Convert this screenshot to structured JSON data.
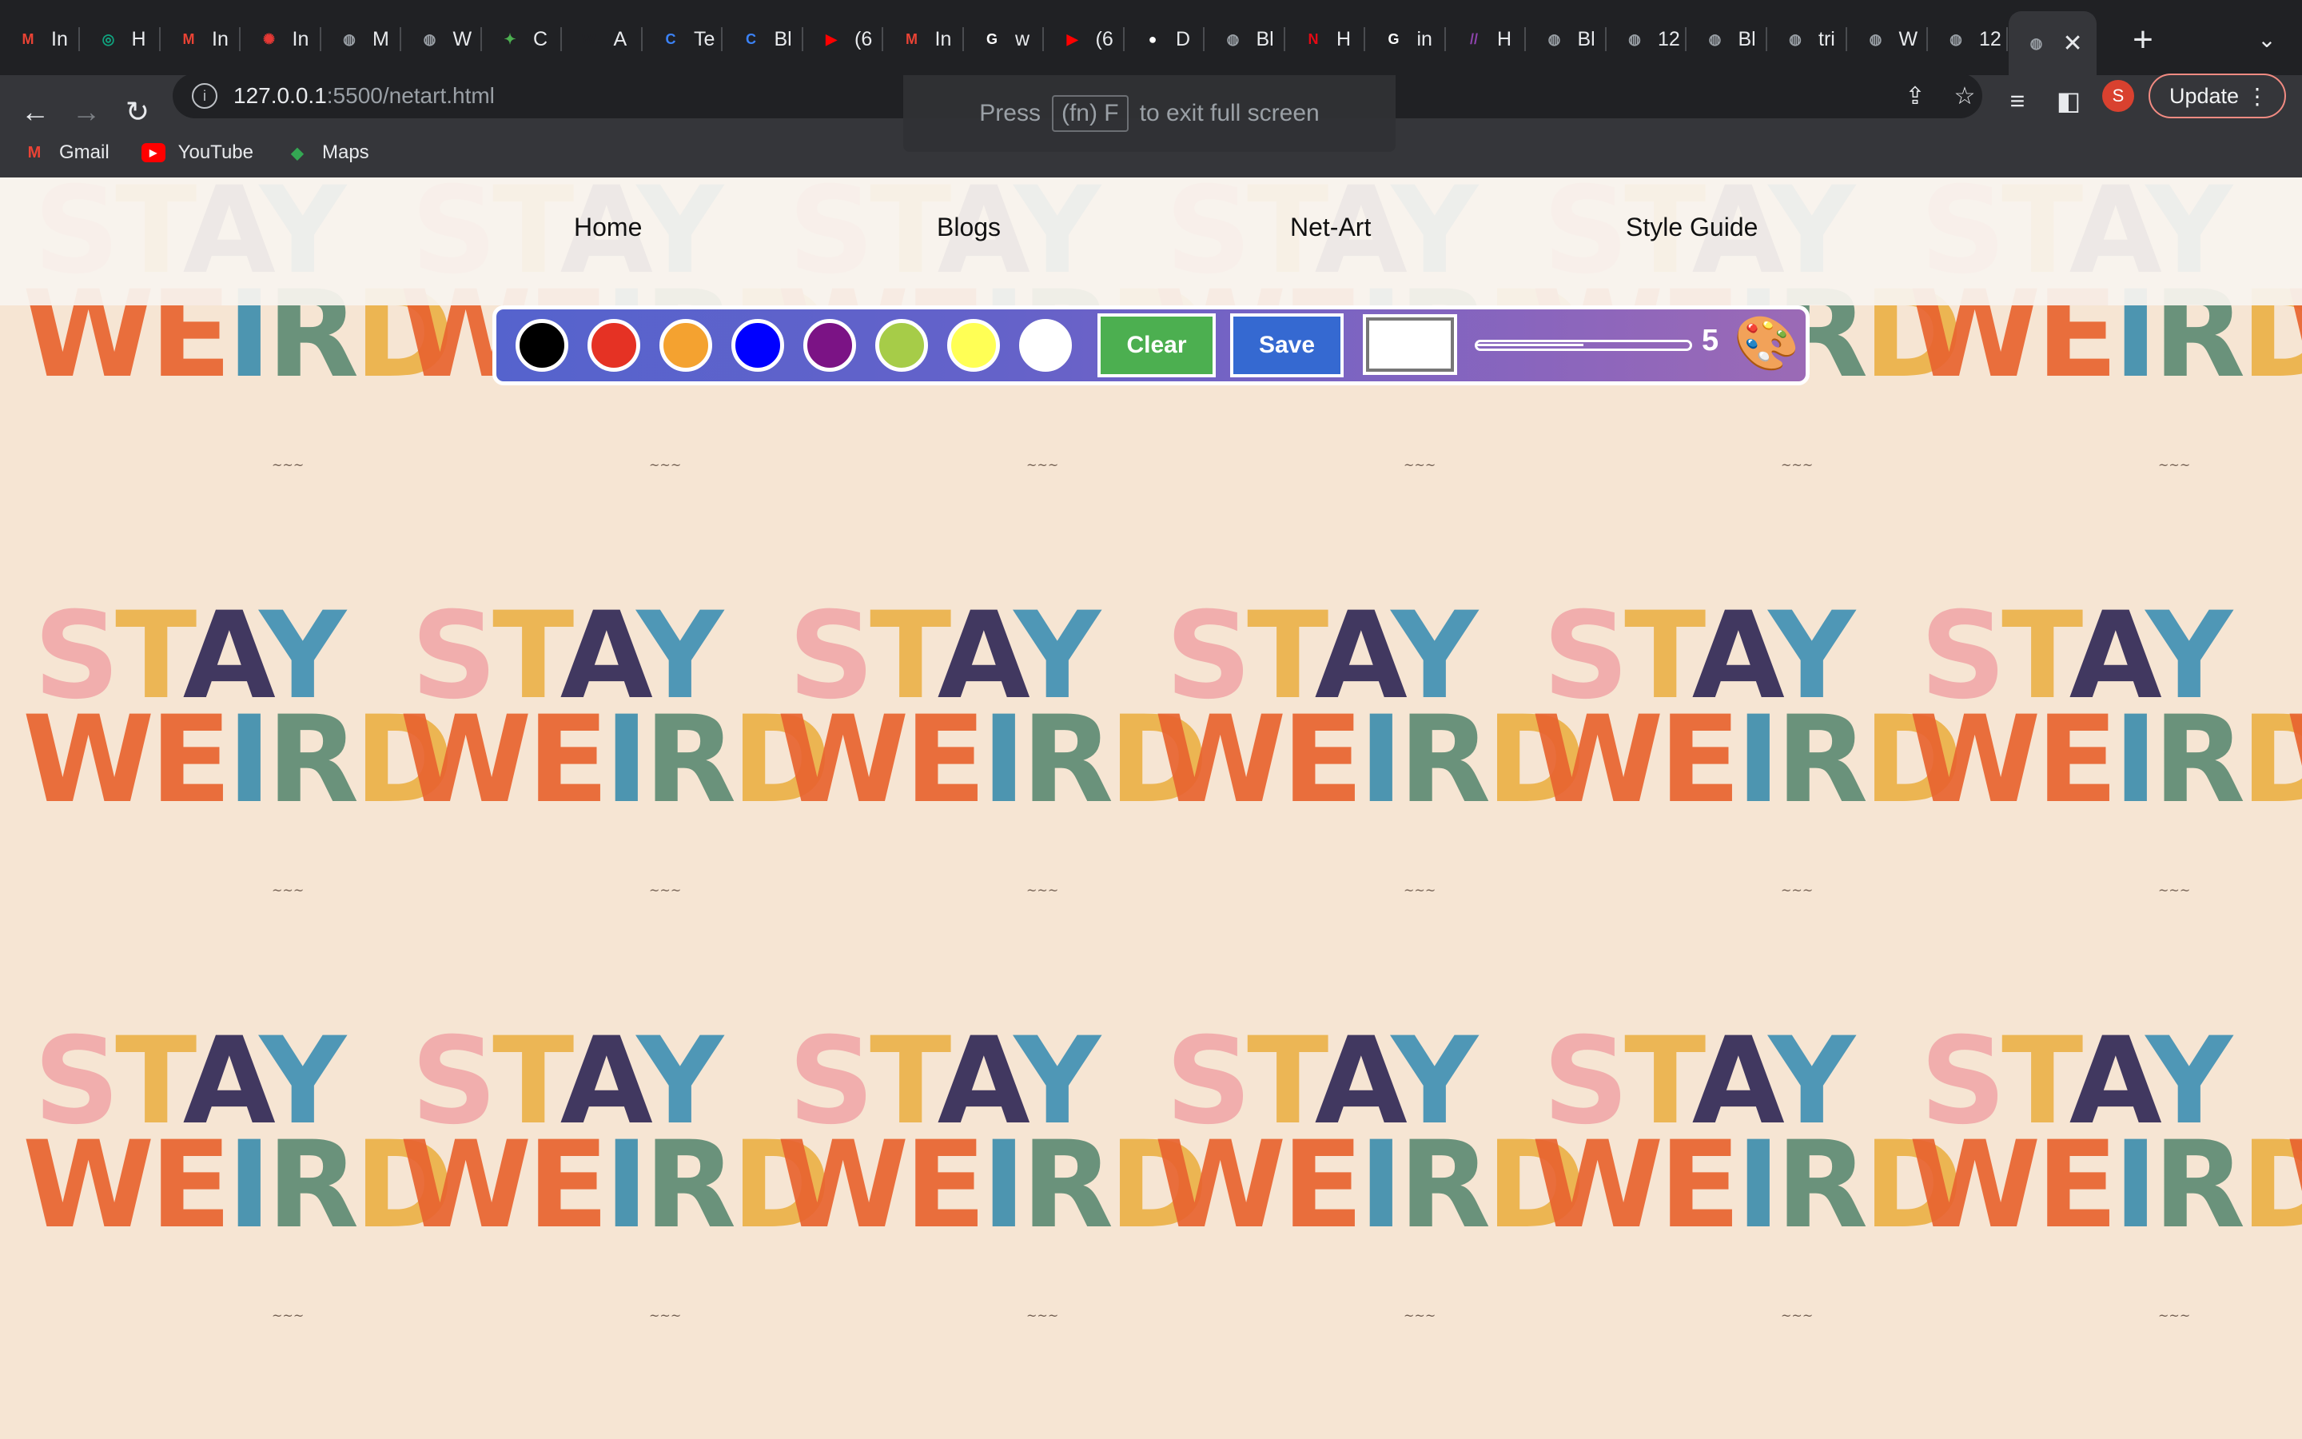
{
  "browser": {
    "tabs": [
      {
        "title": "In",
        "icon": "gmail-icon",
        "color": "#ea4335",
        "glyph": "M"
      },
      {
        "title": "H",
        "icon": "chatgpt-icon",
        "color": "#10a37f",
        "glyph": "◎"
      },
      {
        "title": "In",
        "icon": "gmail-icon",
        "color": "#ea4335",
        "glyph": "M"
      },
      {
        "title": "In",
        "icon": "red-sun-icon",
        "color": "#e53935",
        "glyph": "✺"
      },
      {
        "title": "M",
        "icon": "globe-icon",
        "color": "#9aa0a6",
        "glyph": "◍"
      },
      {
        "title": "W",
        "icon": "globe-icon",
        "color": "#9aa0a6",
        "glyph": "◍"
      },
      {
        "title": "C",
        "icon": "colorful-logo-icon",
        "color": "#4caf50",
        "glyph": "✦"
      },
      {
        "title": "A",
        "icon": "w-logo-icon",
        "color": "#202124",
        "glyph": "W."
      },
      {
        "title": "Te",
        "icon": "canva-icon",
        "color": "#3b82f6",
        "glyph": "C"
      },
      {
        "title": "Bl",
        "icon": "canva-icon",
        "color": "#3b82f6",
        "glyph": "C"
      },
      {
        "title": "(6",
        "icon": "youtube-icon",
        "color": "#ff0000",
        "glyph": "▶"
      },
      {
        "title": "In",
        "icon": "gmail-icon",
        "color": "#ea4335",
        "glyph": "M"
      },
      {
        "title": "w",
        "icon": "google-icon",
        "color": "#ffffff",
        "glyph": "G"
      },
      {
        "title": "(6",
        "icon": "youtube-icon",
        "color": "#ff0000",
        "glyph": "▶"
      },
      {
        "title": "D",
        "icon": "github-icon",
        "color": "#ffffff",
        "glyph": "●"
      },
      {
        "title": "Bl",
        "icon": "globe-icon",
        "color": "#9aa0a6",
        "glyph": "◍"
      },
      {
        "title": "H",
        "icon": "netflix-icon",
        "color": "#e50914",
        "glyph": "N"
      },
      {
        "title": "in",
        "icon": "google-icon",
        "color": "#ffffff",
        "glyph": "G"
      },
      {
        "title": "H",
        "icon": "stripes-icon",
        "color": "#8e44ad",
        "glyph": "//"
      },
      {
        "title": "Bl",
        "icon": "globe-icon",
        "color": "#9aa0a6",
        "glyph": "◍"
      },
      {
        "title": "12",
        "icon": "globe-icon",
        "color": "#9aa0a6",
        "glyph": "◍"
      },
      {
        "title": "Bl",
        "icon": "globe-icon",
        "color": "#9aa0a6",
        "glyph": "◍"
      },
      {
        "title": "tri",
        "icon": "globe-icon",
        "color": "#9aa0a6",
        "glyph": "◍"
      },
      {
        "title": "W",
        "icon": "globe-icon",
        "color": "#9aa0a6",
        "glyph": "◍"
      },
      {
        "title": "12",
        "icon": "globe-icon",
        "color": "#9aa0a6",
        "glyph": "◍"
      }
    ],
    "active_tab_icon": "globe-icon",
    "url_host": "127.0.0.1",
    "url_path": ":5500/netart.html",
    "fullscreen_toast": {
      "before": "Press",
      "key": "(fn) F",
      "after": "to exit full screen"
    },
    "update_label": "Update",
    "avatar_initial": "S",
    "bookmarks": [
      {
        "label": "Gmail",
        "icon": "gmail-icon"
      },
      {
        "label": "YouTube",
        "icon": "youtube-icon"
      },
      {
        "label": "Maps",
        "icon": "maps-icon"
      }
    ]
  },
  "page": {
    "nav": [
      "Home",
      "Blogs",
      "Net-Art",
      "Style Guide"
    ],
    "background_word_1": "STAY",
    "background_word_2": "WEIRD",
    "background_signature": "~~~",
    "draw_toolbar": {
      "swatches": [
        "#000000",
        "#e53224",
        "#f4a230",
        "#0000ff",
        "#7b1385",
        "#a6cc48",
        "#ffff55",
        "#ffffff"
      ],
      "clear_label": "Clear",
      "clear_color": "#4caf50",
      "save_label": "Save",
      "save_color": "#3569d1",
      "picker_color": "#ffffff",
      "brush_size": "5",
      "brush_size_fraction": 0.5
    }
  }
}
